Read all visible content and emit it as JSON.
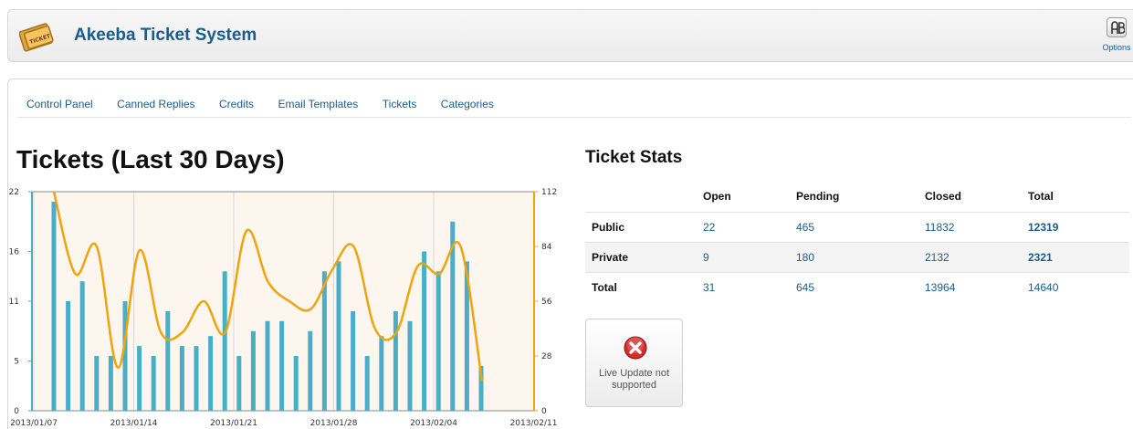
{
  "header": {
    "title": "Akeeba Ticket System",
    "options_label": "Options",
    "logo_text": "TICKET"
  },
  "nav": {
    "items": [
      "Control Panel",
      "Canned Replies",
      "Credits",
      "Email Templates",
      "Tickets",
      "Categories"
    ]
  },
  "chart_section": {
    "heading": "Tickets (Last 30 Days)"
  },
  "stats": {
    "heading": "Ticket Stats",
    "columns": [
      "",
      "Open",
      "Pending",
      "Closed",
      "Total"
    ],
    "rows": [
      {
        "label": "Public",
        "open": "22",
        "pending": "465",
        "closed": "11832",
        "total": "12319"
      },
      {
        "label": "Private",
        "open": "9",
        "pending": "180",
        "closed": "2132",
        "total": "2321"
      },
      {
        "label": "Total",
        "open": "31",
        "pending": "645",
        "closed": "13964",
        "total": "14640"
      }
    ]
  },
  "live_update": {
    "text": "Live Update not supported"
  },
  "colors": {
    "bar": "#49aec8",
    "line": "#f0a30a",
    "link": "#1a5d8a",
    "plot_bg": "#fdf6ef"
  },
  "chart_data": {
    "type": "bar",
    "x_tick_labels": [
      "2013/01/07",
      "2013/01/14",
      "2013/01/21",
      "2013/01/28",
      "2013/02/04",
      "2013/02/11"
    ],
    "y_left_ticks": [
      0,
      5,
      11,
      16,
      22
    ],
    "y_right_ticks": [
      0,
      28,
      56,
      84,
      112
    ],
    "ylim_left": [
      0,
      22
    ],
    "ylim_right": [
      0,
      112
    ],
    "series": [
      {
        "values": [
          21,
          11,
          13,
          5.5,
          5.5,
          11,
          6.5,
          5.5,
          10,
          6.5,
          6.5,
          7.5,
          14,
          5.5,
          8,
          9,
          9,
          5.5,
          8,
          14,
          15,
          10,
          5.5,
          7.5,
          10,
          9,
          16,
          14,
          19,
          15,
          4.5
        ]
      },
      {
        "values": [
          112,
          70,
          84,
          22,
          82,
          40,
          40,
          56,
          40,
          92,
          66,
          56,
          52,
          72,
          84,
          42,
          40,
          74,
          70,
          84,
          15
        ]
      }
    ]
  }
}
